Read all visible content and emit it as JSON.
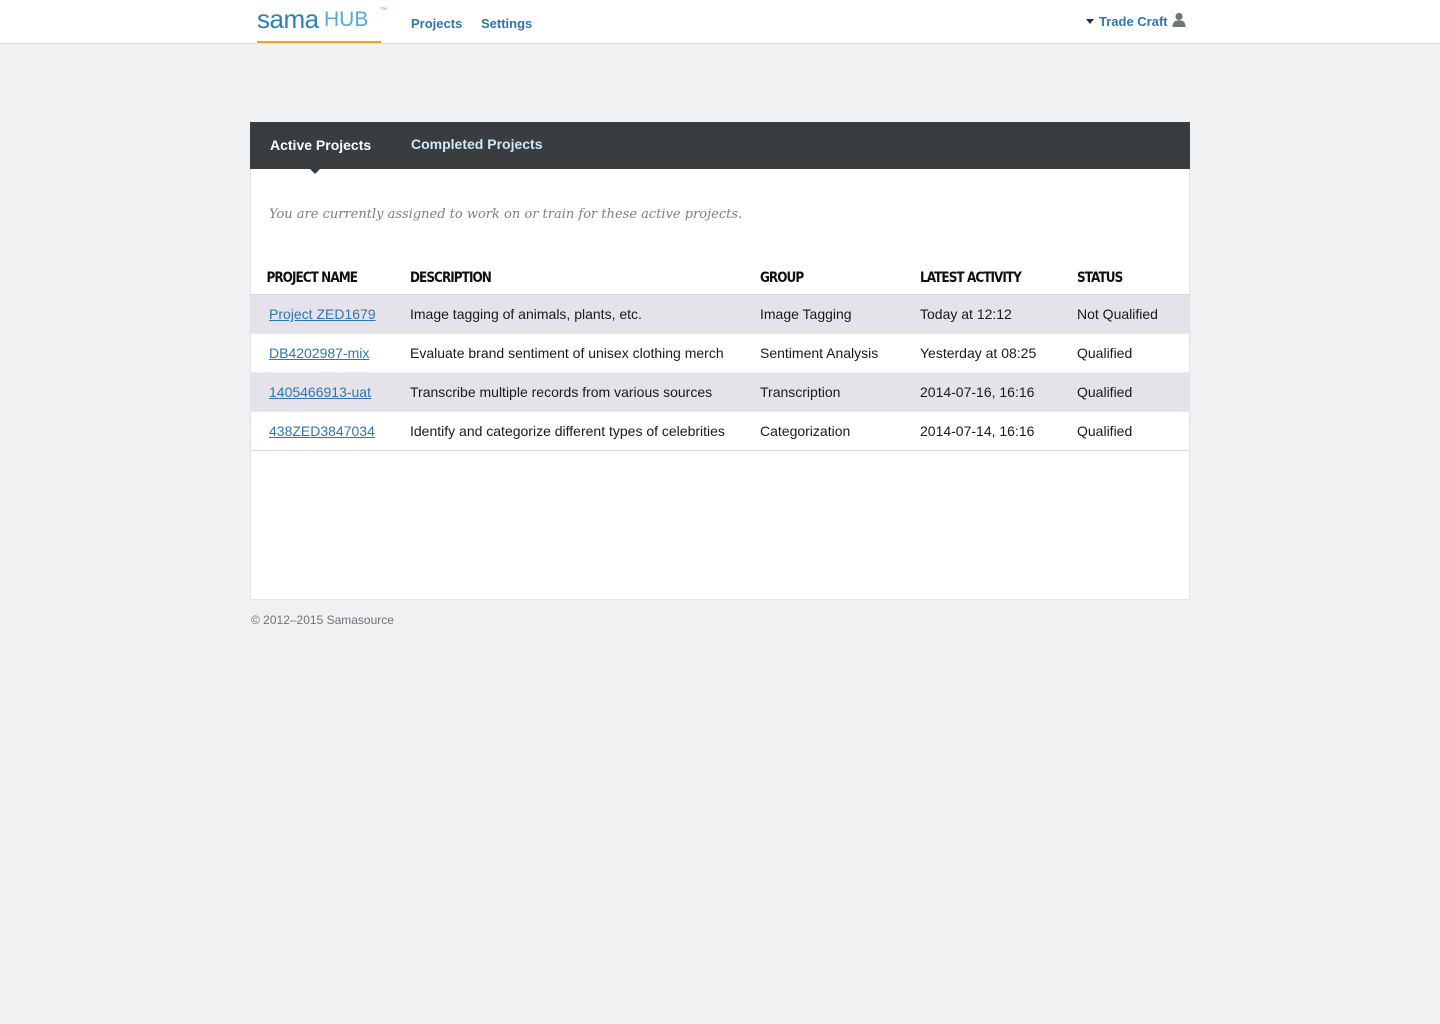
{
  "header": {
    "logo": {
      "primary": "sama",
      "secondary": "HUB",
      "trademark": "™"
    },
    "nav": [
      {
        "label": "Projects"
      },
      {
        "label": "Settings"
      }
    ],
    "user": {
      "name": "Trade Craft",
      "icon": "user-icon"
    }
  },
  "tabs": {
    "active": "Active Projects",
    "completed": "Completed Projects"
  },
  "intro": "You are currently assigned to work on or train for these active projects.",
  "table": {
    "headers": [
      "PROJECT NAME",
      "DESCRIPTION",
      "GROUP",
      "LATEST ACTIVITY",
      "STATUS"
    ],
    "rows": [
      {
        "name": "Project ZED1679",
        "description": "Image tagging of animals, plants, etc.",
        "group": "Image Tagging",
        "activity": "Today at 12:12",
        "status": "Not Qualified"
      },
      {
        "name": "DB4202987-mix",
        "description": "Evaluate brand sentiment of unisex clothing merch",
        "group": "Sentiment Analysis",
        "activity": "Yesterday at 08:25",
        "status": "Qualified"
      },
      {
        "name": "1405466913-uat",
        "description": "Transcribe multiple records from various sources",
        "group": "Transcription",
        "activity": "2014-07-16, 16:16",
        "status": "Qualified"
      },
      {
        "name": "438ZED3847034",
        "description": "Identify and categorize different types of celebrities",
        "group": "Categorization",
        "activity": "2014-07-14, 16:16",
        "status": "Qualified"
      }
    ]
  },
  "footer": "© 2012–2015 Samasource",
  "colors": {
    "link": "#2f76b0",
    "qualified": "#3f7a1a",
    "tabbar": "#3a3d40",
    "accent": "#f0a21e",
    "row_shade": "#e6e2ea"
  }
}
